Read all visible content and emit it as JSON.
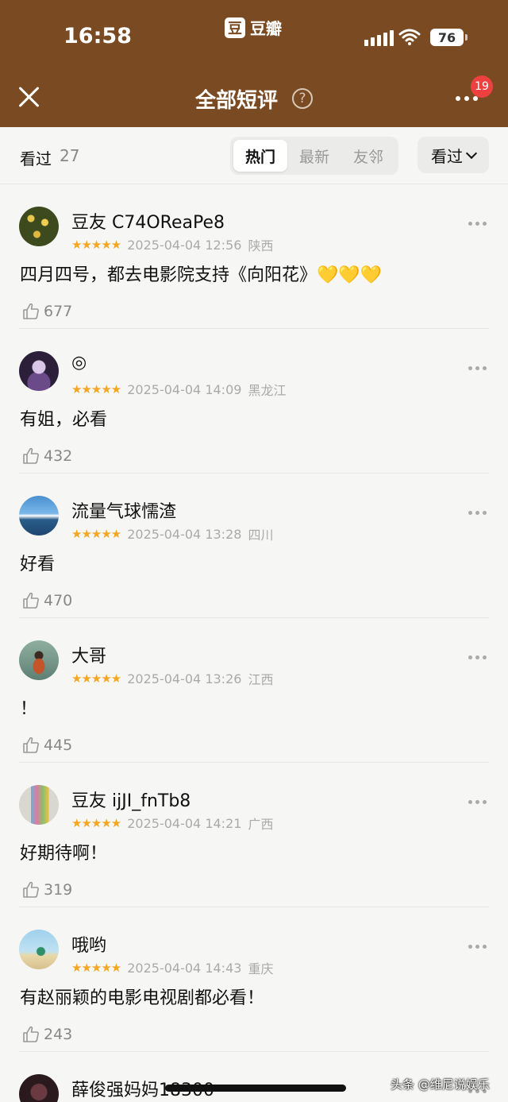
{
  "status": {
    "time": "16:58",
    "app_name": "豆瓣",
    "app_logo": "豆",
    "battery": "76"
  },
  "header": {
    "title": "全部短评",
    "help": "?",
    "notification_count": "19"
  },
  "filter": {
    "seen_label": "看过",
    "seen_count": "27",
    "tabs": [
      "热门",
      "最新",
      "友邻"
    ],
    "active_tab": "热门",
    "dropdown_label": "看过"
  },
  "comments": [
    {
      "user": "豆友 C74OReaPe8",
      "rating": "★★★★★",
      "time": "2025-04-04 12:56",
      "location": "陕西",
      "text": "四月四号，都去电影院支持《向阳花》💛💛💛",
      "likes": "677"
    },
    {
      "user": "◎",
      "rating": "★★★★★",
      "time": "2025-04-04 14:09",
      "location": "黑龙江",
      "text": "有姐，必看",
      "likes": "432"
    },
    {
      "user": "流量气球懦渣",
      "rating": "★★★★★",
      "time": "2025-04-04 13:28",
      "location": "四川",
      "text": "好看",
      "likes": "470"
    },
    {
      "user": "大哥",
      "rating": "★★★★★",
      "time": "2025-04-04 13:26",
      "location": "江西",
      "text": "！",
      "likes": "445"
    },
    {
      "user": "豆友 ijJI_fnTb8",
      "rating": "★★★★★",
      "time": "2025-04-04 14:21",
      "location": "广西",
      "text": "好期待啊！",
      "likes": "319"
    },
    {
      "user": "哦哟",
      "rating": "★★★★★",
      "time": "2025-04-04 14:43",
      "location": "重庆",
      "text": "有赵丽颖的电影电视剧都必看！",
      "likes": "243"
    },
    {
      "user": "薛俊强妈妈18300"
    }
  ],
  "watermark": "头条 @维尼说娱乐",
  "colors": {
    "brand_brown": "#7a4b22",
    "star": "#f5a623",
    "badge": "#ef4040"
  }
}
